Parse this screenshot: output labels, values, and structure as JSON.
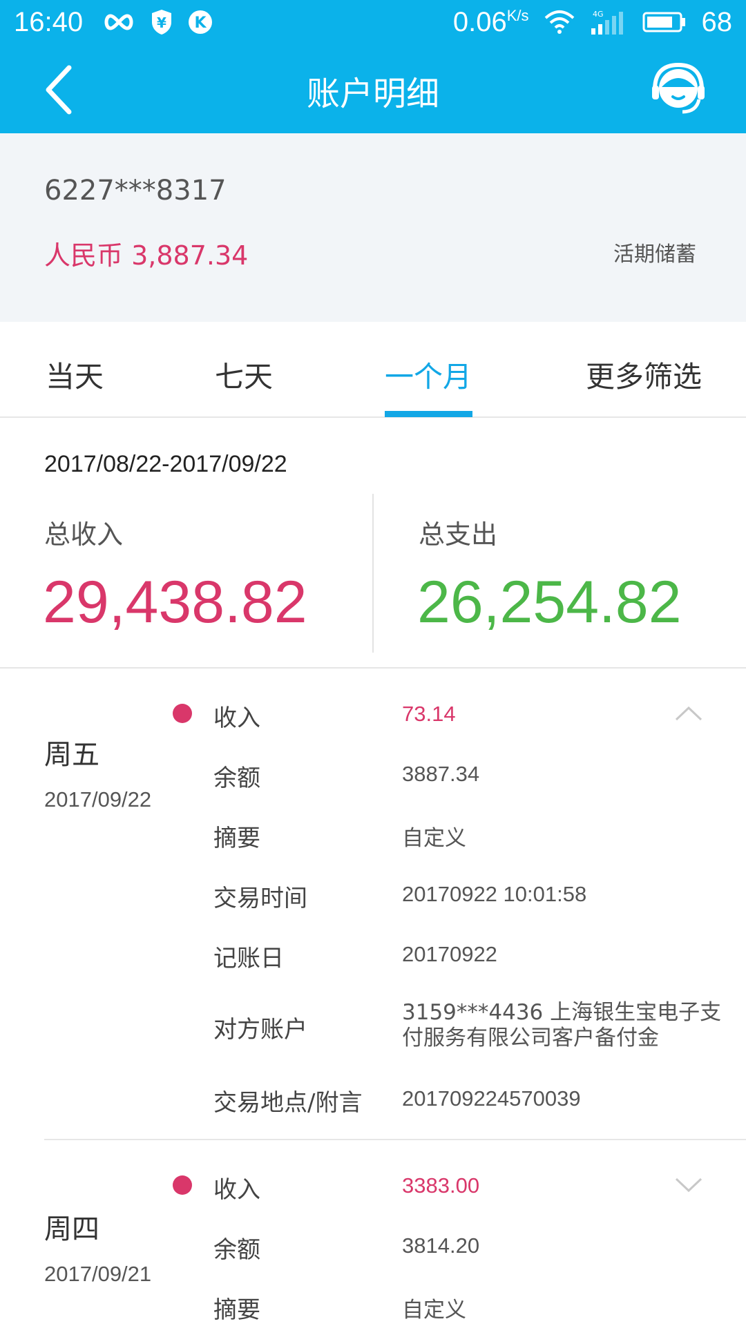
{
  "status_bar": {
    "time": "16:40",
    "net_speed": "0.06",
    "net_unit": "K/s",
    "battery": "68",
    "icons": [
      "infinity-icon",
      "shield-yen-icon",
      "k-app-icon",
      "wifi-icon",
      "signal-4g-icon",
      "battery-icon"
    ]
  },
  "nav": {
    "title": "账户明细",
    "back_icon": "back-arrow-icon",
    "service_icon": "customer-service-icon"
  },
  "account": {
    "number": "6227***8317",
    "balance": "人民币 3,887.34",
    "type": "活期储蓄"
  },
  "tabs": [
    {
      "label": "当天",
      "active": false
    },
    {
      "label": "七天",
      "active": false
    },
    {
      "label": "一个月",
      "active": true
    },
    {
      "label": "更多筛选",
      "active": false
    }
  ],
  "summary": {
    "date_range": "2017/08/22-2017/09/22",
    "income_label": "总收入",
    "income_value": "29,438.82",
    "expense_label": "总支出",
    "expense_value": "26,254.82"
  },
  "transactions": [
    {
      "weekday": "周五",
      "date": "2017/09/22",
      "expanded": true,
      "chevron_icon": "chevron-up-icon",
      "rows": [
        {
          "label": "收入",
          "value": "73.14"
        },
        {
          "label": "余额",
          "value": "3887.34"
        },
        {
          "label": "摘要",
          "value": "自定义"
        },
        {
          "label": "交易时间",
          "value": "20170922 10:01:58"
        },
        {
          "label": "记账日",
          "value": "20170922"
        },
        {
          "label": "对方账户",
          "value": "3159***4436 上海银生宝电子支付服务有限公司客户备付金"
        },
        {
          "label": "交易地点/附言",
          "value": "201709224570039"
        }
      ]
    },
    {
      "weekday": "周四",
      "date": "2017/09/21",
      "expanded": false,
      "chevron_icon": "chevron-down-icon",
      "rows": [
        {
          "label": "收入",
          "value": "3383.00"
        },
        {
          "label": "余额",
          "value": "3814.20"
        },
        {
          "label": "摘要",
          "value": "自定义"
        }
      ]
    }
  ],
  "colors": {
    "header": "#0bb2ea",
    "accent_blue": "#12a7e6",
    "income": "#d9376a",
    "expense": "#4cb748",
    "account_bg": "#f2f5f8"
  }
}
